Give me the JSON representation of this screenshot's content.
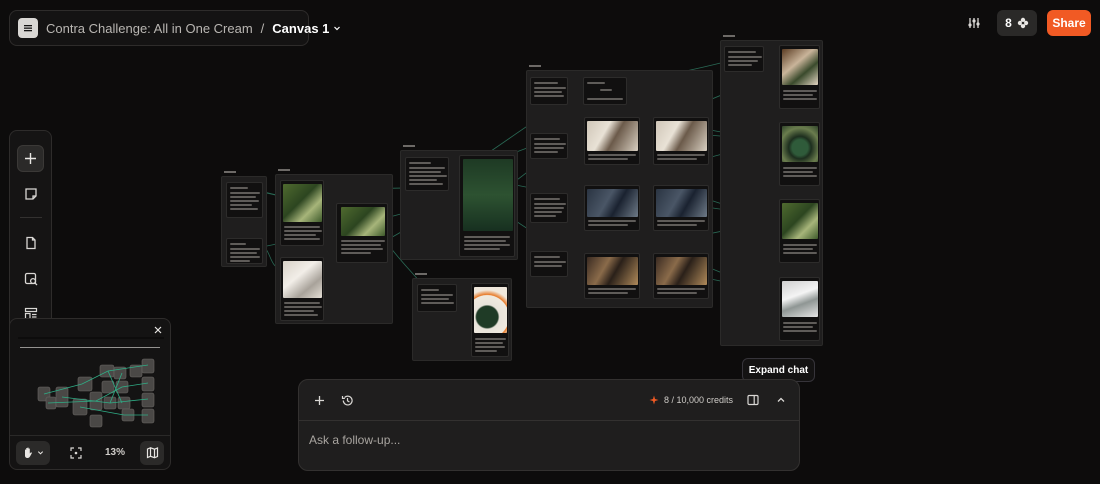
{
  "header": {
    "project_name": "Contra Challenge: All in One Cream",
    "separator": "/",
    "canvas_name": "Canvas 1"
  },
  "topbar": {
    "credit_count": "8",
    "share_label": "Share",
    "icons": [
      "sliders-icon",
      "flower-icon"
    ]
  },
  "toolrail": {
    "tools": [
      "plus-icon",
      "sticky-note-icon",
      "document-icon",
      "image-search-icon",
      "layout-icon",
      "help-icon"
    ]
  },
  "minimap": {
    "zoom": "13%",
    "icons": [
      "close-icon",
      "hand-icon",
      "chevron-down-icon",
      "fit-icon",
      "map-icon"
    ]
  },
  "chat": {
    "credits": "8 / 10,000 credits",
    "placeholder": "Ask a follow-up...",
    "expand_tooltip": "Expand chat",
    "icons": [
      "plus-icon",
      "history-icon",
      "sparkle-icon",
      "panel-icon",
      "chevron-up-icon"
    ]
  },
  "colors": {
    "background": "#0d0c0c",
    "accent": "#f15a24",
    "connector": "#2f7a62"
  }
}
